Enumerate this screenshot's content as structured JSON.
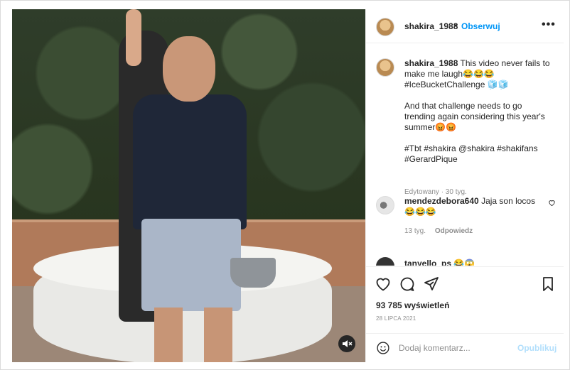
{
  "video": {
    "mute_icon": "speaker-muted-icon"
  },
  "header": {
    "username": "shakira_1988",
    "separator": "•",
    "follow_label": "Obserwuj",
    "more_icon": "more-horizontal-icon",
    "more_label": "•••"
  },
  "caption": {
    "username": "shakira_1988",
    "line1": "This video never fails to make me laugh😂😂😂 #IceBucketChallenge 🧊🧊",
    "line2": "And that challenge needs to go trending again considering this year's summer😡😡",
    "line3": "#Tbt #shakira @shakira #shakifans #GerardPique",
    "edited": "Edytowany · 30 tyg."
  },
  "comments": [
    {
      "username": "mendezdebora640",
      "text": "Jaja son locos 😂😂😂",
      "time": "13 tyg.",
      "reply_label": "Odpowiedz",
      "like_icon": "heart-outline-icon"
    },
    {
      "username": "tanyello_ps",
      "text": "😂😱"
    }
  ],
  "actions": {
    "like_icon": "heart-outline-icon",
    "comment_icon": "comment-bubble-icon",
    "share_icon": "paper-plane-icon",
    "save_icon": "bookmark-icon"
  },
  "stats": {
    "views": "93 785 wyświetleń",
    "date": "28 LIPCA 2021"
  },
  "add_comment": {
    "emoji_icon": "emoji-smile-icon",
    "placeholder": "Dodaj komentarz...",
    "post_label": "Opublikuj"
  }
}
